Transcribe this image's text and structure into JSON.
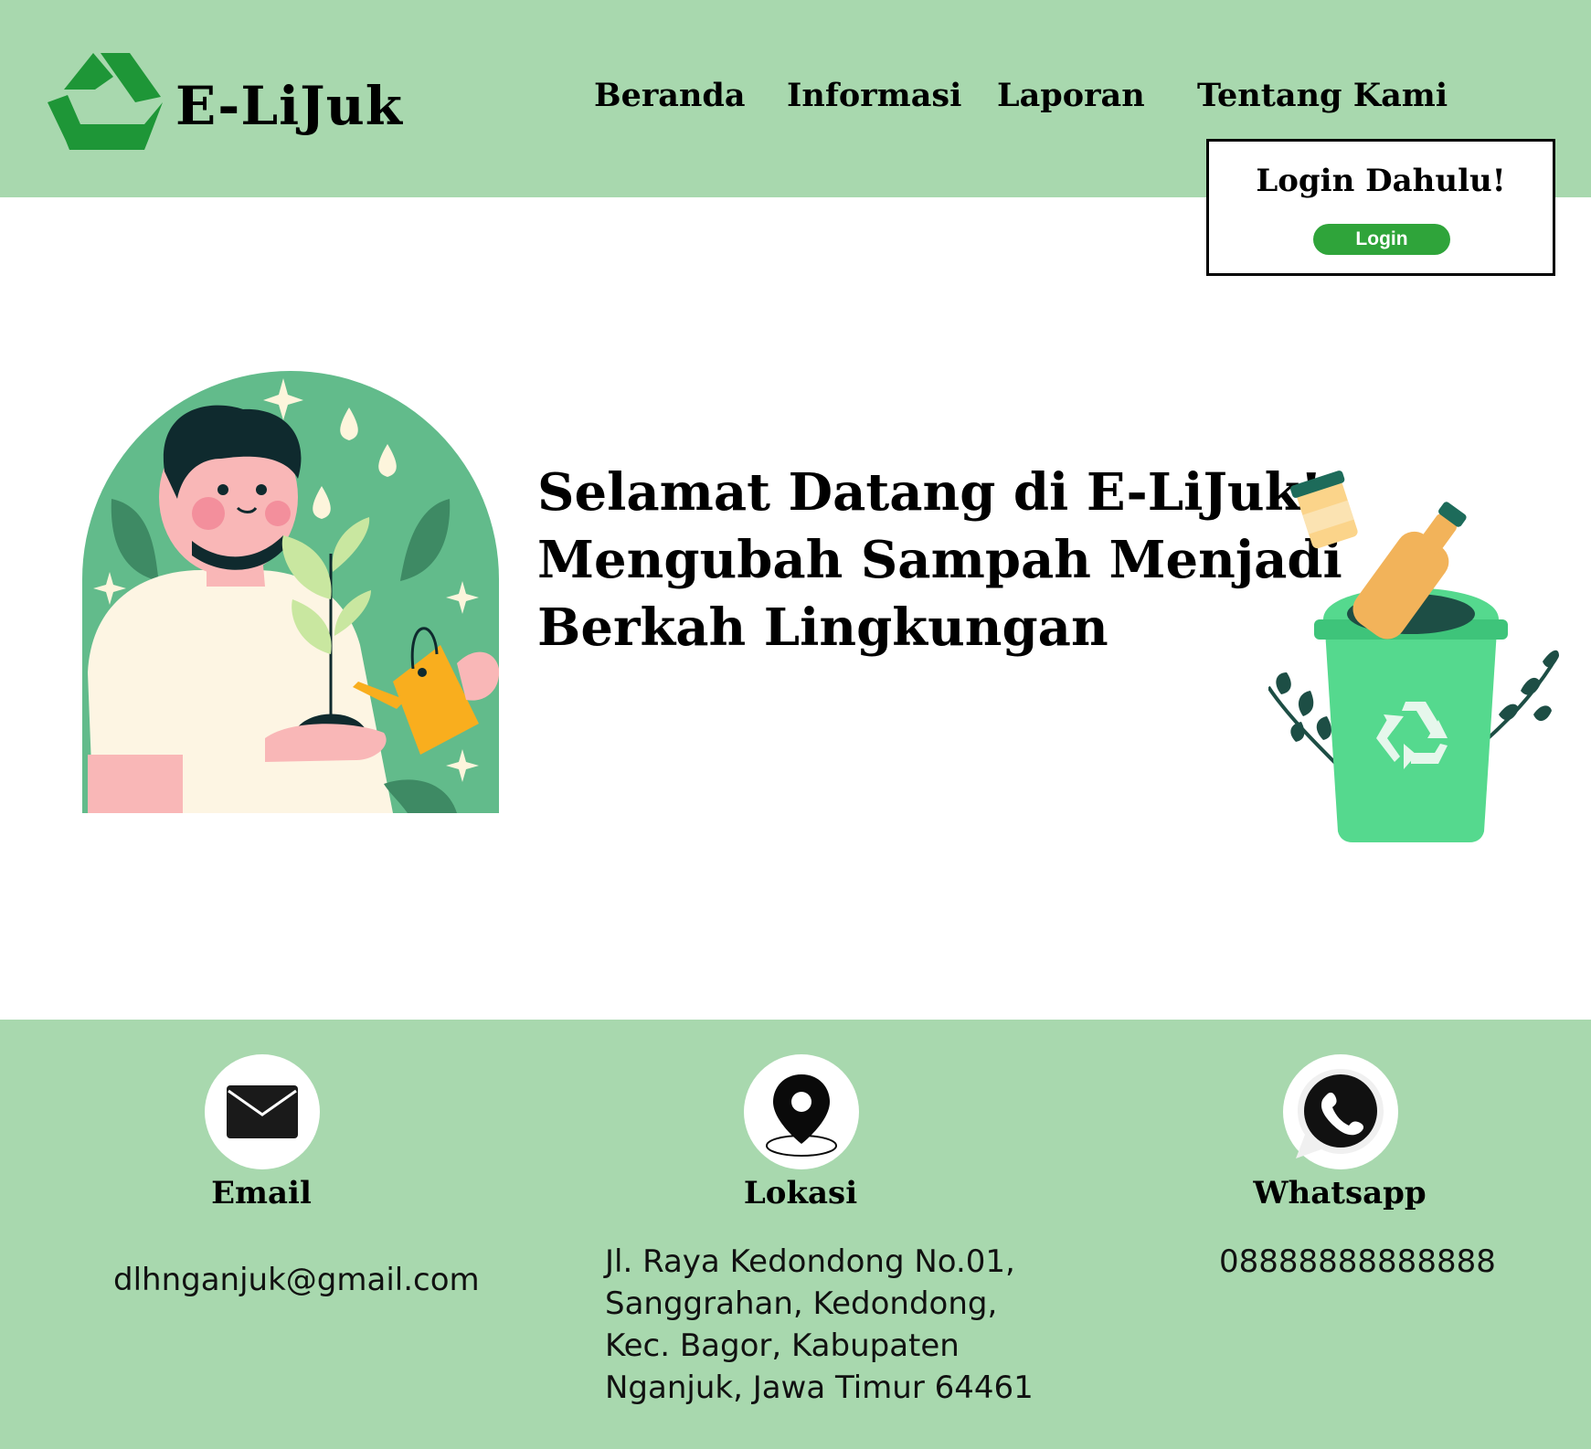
{
  "header": {
    "brand": "E-LiJuk",
    "nav": [
      "Beranda",
      "Informasi",
      "Laporan",
      "Tentang Kami"
    ]
  },
  "login_box": {
    "title": "Login Dahulu!",
    "button_label": "Login"
  },
  "hero": {
    "lines": [
      "Selamat Datang di E-LiJuk!",
      "Mengubah Sampah Menjadi",
      "Berkah Lingkungan"
    ]
  },
  "footer": {
    "email": {
      "label": "Email",
      "value": "dlhnganjuk@gmail.com",
      "icon": "envelope-icon"
    },
    "location": {
      "label": "Lokasi",
      "lines": [
        "Jl. Raya Kedondong No.01,",
        "Sanggrahan, Kedondong,",
        "Kec. Bagor, Kabupaten",
        "Nganjuk, Jawa Timur 64461"
      ],
      "icon": "map-pin-icon"
    },
    "whatsapp": {
      "label": "Whatsapp",
      "value": "08888888888888",
      "icon": "whatsapp-icon"
    }
  },
  "colors": {
    "band": "#a8d8ae",
    "brand_green": "#1e9637",
    "button_green": "#2fa43a",
    "bin_green": "#55d98e"
  }
}
